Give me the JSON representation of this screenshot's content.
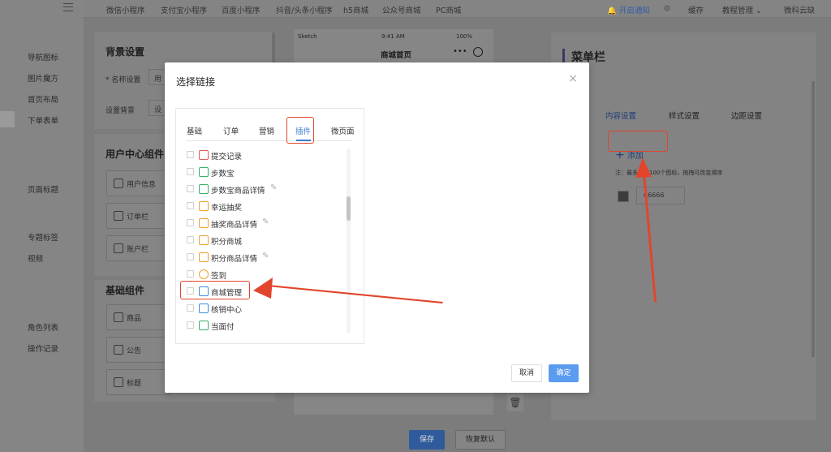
{
  "sidebar": {
    "items": [
      "导航图标",
      "图片魔方",
      "首页布局",
      "下单表单",
      "页面标题",
      "专题标签",
      "视频",
      "角色列表",
      "操作记录"
    ]
  },
  "topbar": {
    "menu_icon": "menu-icon",
    "nav": [
      "微信小程序",
      "支付宝小程序",
      "百度小程序",
      "抖音/头条小程序",
      "h5商城",
      "公众号商城",
      "PC商城"
    ],
    "notify": "开启通知",
    "cache": "缓存",
    "tutorial": "教程管理",
    "cloud": "微科云缺"
  },
  "left_panel": {
    "title": "背景设置",
    "name_label": "* 名称设置",
    "name_value": "用",
    "bg_label": "设置背景",
    "bg_value": "设",
    "user_center": {
      "title": "用户中心组件",
      "items": [
        "用户信息",
        "订单栏",
        "账户栏"
      ]
    },
    "basic": {
      "title": "基础组件",
      "items": [
        "商品",
        "公告",
        "标题"
      ]
    }
  },
  "phone": {
    "carrier": "Sketch",
    "time": "9:41 AM",
    "battery": "100%",
    "title": "商城首页"
  },
  "right_panel": {
    "title": "菜单栏",
    "tabs": [
      "内容设置",
      "样式设置",
      "边距设置"
    ],
    "add": "添加",
    "note": "注：最多添加100个图标，拖拽可改变顺序",
    "color_value": "66666"
  },
  "footer": {
    "save": "保存",
    "reset": "恢复默认"
  },
  "modal": {
    "title": "选择链接",
    "close": "×",
    "tabs": [
      "基础",
      "订单",
      "营销",
      "插件",
      "微页面"
    ],
    "active_tab": "插件",
    "items": [
      {
        "label": "提交记录",
        "icon": "form-icon",
        "color": "#e25b5b",
        "editable": false
      },
      {
        "label": "步数宝",
        "icon": "steps-icon",
        "color": "#35b36b",
        "editable": false
      },
      {
        "label": "步数宝商品详情",
        "icon": "steps-icon",
        "color": "#35b36b",
        "editable": true
      },
      {
        "label": "幸运抽奖",
        "icon": "gift-icon",
        "color": "#f0a030",
        "editable": false
      },
      {
        "label": "抽奖商品详情",
        "icon": "gift-icon",
        "color": "#f0a030",
        "editable": true
      },
      {
        "label": "积分商城",
        "icon": "points-icon",
        "color": "#f0a030",
        "editable": false
      },
      {
        "label": "积分商品详情",
        "icon": "points-icon",
        "color": "#f0a030",
        "editable": true
      },
      {
        "label": "签到",
        "icon": "checkin-icon",
        "color": "#f0a030",
        "editable": false
      },
      {
        "label": "商城管理",
        "icon": "store-icon",
        "color": "#3d8de0",
        "editable": false
      },
      {
        "label": "核销中心",
        "icon": "verify-icon",
        "color": "#3d8de0",
        "editable": false
      },
      {
        "label": "当面付",
        "icon": "pay-icon",
        "color": "#35b36b",
        "editable": false
      }
    ],
    "cancel": "取消",
    "confirm": "确定"
  },
  "colors": {
    "accent": "#3a7bd5",
    "highlight": "#e2452c",
    "confirm_bg": "#5b9bf0"
  }
}
